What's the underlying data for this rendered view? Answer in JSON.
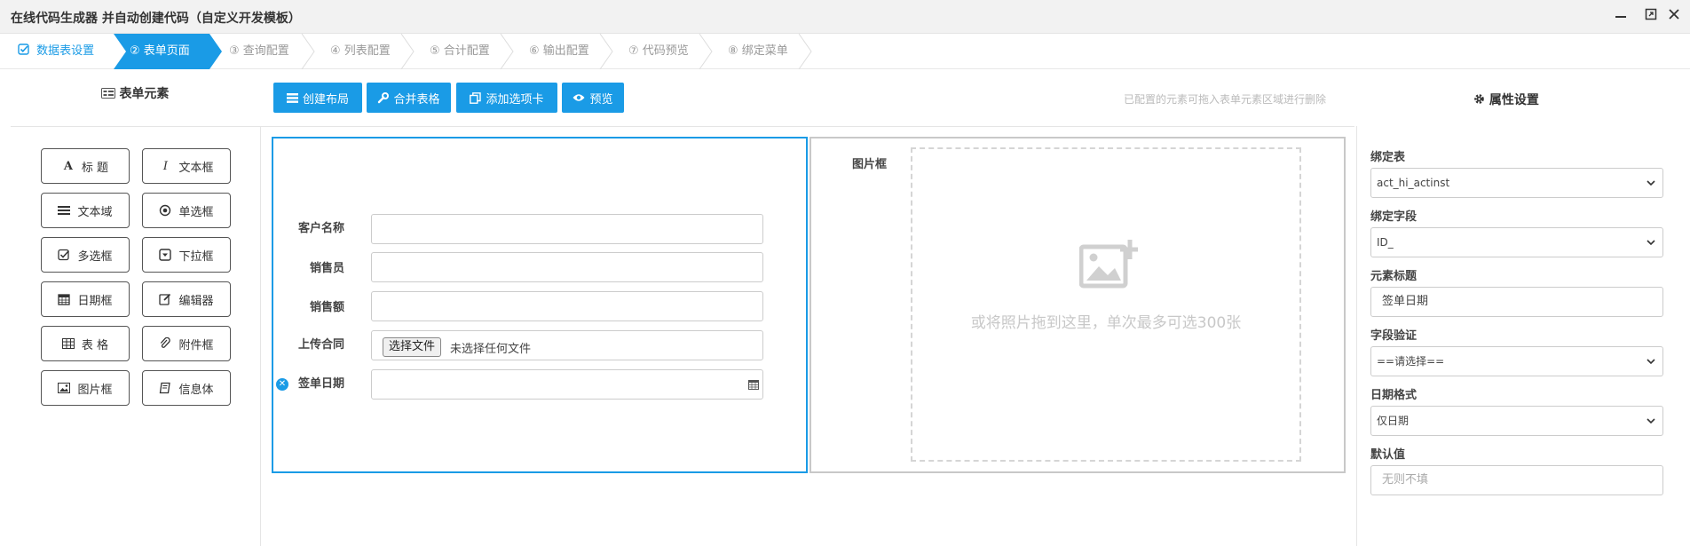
{
  "window": {
    "title": "在线代码生成器 并自动创建代码（自定义开发模板）",
    "minimize_icon": "minimize-icon",
    "maximize_icon": "maximize-icon",
    "close_icon": "close-icon"
  },
  "steps": [
    {
      "label": "数据表设置",
      "state": "done"
    },
    {
      "label": "② 表单页面",
      "state": "active"
    },
    {
      "label": "③ 查询配置",
      "state": "pending"
    },
    {
      "label": "④ 列表配置",
      "state": "pending"
    },
    {
      "label": "⑤ 合计配置",
      "state": "pending"
    },
    {
      "label": "⑥ 输出配置",
      "state": "pending"
    },
    {
      "label": "⑦ 代码预览",
      "state": "pending"
    },
    {
      "label": "⑧ 绑定菜单",
      "state": "pending"
    }
  ],
  "palette": {
    "heading": "表单元素",
    "items": [
      {
        "label": "标 题",
        "icon": "font-icon"
      },
      {
        "label": "文本框",
        "icon": "italic-icon"
      },
      {
        "label": "文本域",
        "icon": "lines-icon"
      },
      {
        "label": "单选框",
        "icon": "radio-icon"
      },
      {
        "label": "多选框",
        "icon": "checkbox-icon"
      },
      {
        "label": "下拉框",
        "icon": "dropdown-icon"
      },
      {
        "label": "日期框",
        "icon": "calendar-icon"
      },
      {
        "label": "编辑器",
        "icon": "edit-icon"
      },
      {
        "label": "表 格",
        "icon": "table-icon"
      },
      {
        "label": "附件框",
        "icon": "paperclip-icon"
      },
      {
        "label": "图片框",
        "icon": "image-icon"
      },
      {
        "label": "信息体",
        "icon": "book-icon"
      }
    ]
  },
  "toolbar": {
    "create_layout": "创建布局",
    "merge_table": "合并表格",
    "add_tab": "添加选项卡",
    "preview": "预览",
    "hint": "已配置的元素可拖入表单元素区域进行删除"
  },
  "form": {
    "fields": [
      {
        "label": "客户名称",
        "value": ""
      },
      {
        "label": "销售员",
        "value": ""
      },
      {
        "label": "销售额",
        "value": ""
      },
      {
        "label": "上传合同",
        "file_button": "选择文件",
        "file_text": "未选择任何文件"
      },
      {
        "label": "签单日期",
        "value": ""
      }
    ]
  },
  "image_panel": {
    "label": "图片框",
    "drop_text": "或将照片拖到这里，单次最多可选300张"
  },
  "properties": {
    "heading": "属性设置",
    "bind_table_label": "绑定表",
    "bind_table_value": "act_hi_actinst",
    "bind_field_label": "绑定字段",
    "bind_field_value": "ID_",
    "element_title_label": "元素标题",
    "element_title_value": "签单日期",
    "validation_label": "字段验证",
    "validation_value": "==请选择==",
    "date_format_label": "日期格式",
    "date_format_value": "仅日期",
    "default_label": "默认值",
    "default_placeholder": "无则不填"
  },
  "colors": {
    "accent": "#1a9be6",
    "border": "#cccccc"
  }
}
